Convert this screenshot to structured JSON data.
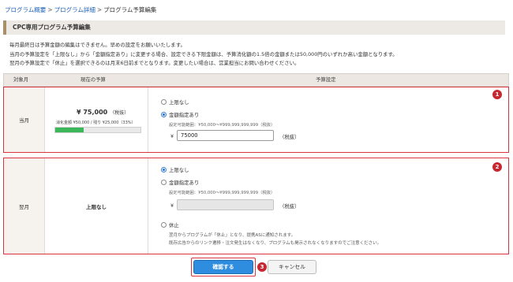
{
  "breadcrumb": {
    "items": [
      "プログラム概要",
      "プログラム詳細"
    ],
    "current": "プログラム予算編集",
    "separator": ">"
  },
  "section_title": "CPC専用プログラム予算編集",
  "notice_lines": [
    "毎月最終日は予算金額の編集はできません。早めの設定をお願いいたします。",
    "当月の予算設定を「上限なし」から「金額指定あり」に変更する場合、設定できる下限金額は、予算消化額の1.5倍の金額または50,000円のいずれか高い金額となります。",
    "翌月の予算設定で「休止」を選択できるのは月末6日前までとなります。変更したい場合は、営業担当にお問い合わせください。"
  ],
  "table": {
    "headers": {
      "month": "対象月",
      "current": "現在の予算",
      "settings": "予算設定"
    }
  },
  "rows": [
    {
      "badge": "1",
      "month": "当月",
      "amount": "¥ 75,000",
      "tax_label": "（税抜）",
      "consumption": "消化金額 ¥50,000 / 残り ¥25,000（33%）",
      "progress": 0.33,
      "options": {
        "unlimited": "上限なし",
        "specified": "金額指定あり"
      },
      "selected": "specified",
      "range_hint": "設定可能範囲：¥50,000〜¥999,999,999,999（税抜）",
      "yen": "¥",
      "input_value": "75000",
      "tax_after_input": "（税抜）"
    },
    {
      "badge": "2",
      "month": "翌月",
      "current_text": "上限なし",
      "options": {
        "unlimited": "上限なし",
        "specified": "金額指定あり",
        "pause": "休止"
      },
      "selected": "unlimited",
      "range_hint": "設定可能範囲：¥50,000〜¥999,999,999,999（税抜）",
      "yen": "¥",
      "input_value": "",
      "tax_after_input": "（税抜）",
      "pause_notes": [
        "翌月からプログラムが「休止」となり、提携ASに通知されます。",
        "既存広告からのリンク遷移・注文発生はなくなり、プログラムも掲示されなくなりますのでご注意ください。"
      ]
    }
  ],
  "buttons": {
    "confirm": "確認する",
    "cancel": "キャンセル",
    "confirm_badge": "3"
  },
  "colors": {
    "highlight": "#d9343f",
    "badge": "#c62832",
    "primary_button": "#2f8de0",
    "progress": "#3cb75a",
    "section_accent": "#a9906a",
    "link": "#1a5fb4"
  }
}
